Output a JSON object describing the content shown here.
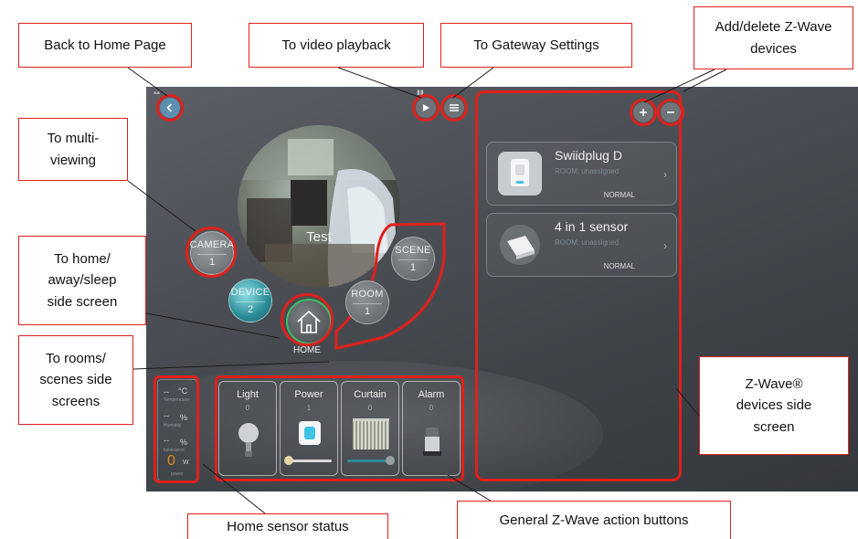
{
  "callouts": {
    "back_home": "Back to Home Page",
    "video_playback": "To video playback",
    "gateway_settings": "To Gateway Settings",
    "add_delete": "Add/delete Z-Wave devices",
    "multi_viewing": "To multi-viewing",
    "home_away": "To home/ away/sleep side screen",
    "rooms_scenes": "To rooms/ scenes side screens",
    "zwave_side": "Z-Wave® devices side screen",
    "sensor_status": "Home sensor status",
    "action_buttons": "General Z-Wave action buttons"
  },
  "camera": {
    "name": "Test"
  },
  "orbs": {
    "camera": {
      "label": "CAMERA",
      "count": "1"
    },
    "scene": {
      "label": "SCENE",
      "count": "1"
    },
    "device": {
      "label": "DEVICE",
      "count": "2"
    },
    "room": {
      "label": "ROOM",
      "count": "1"
    },
    "home": {
      "label": "HOME"
    }
  },
  "devices": [
    {
      "name": "Swiidplug D",
      "room": "ROOM: unassigned",
      "status": "NORMAL"
    },
    {
      "name": "4 in 1 sensor",
      "room": "ROOM: unassigned",
      "status": "NORMAL"
    }
  ],
  "actions": [
    {
      "label": "Light",
      "value": "0"
    },
    {
      "label": "Power",
      "value": "1"
    },
    {
      "label": "Curtain",
      "value": "0"
    },
    {
      "label": "Alarm",
      "value": "0"
    }
  ],
  "sensors": {
    "temp_value": "--",
    "temp_unit": "°C",
    "temp_label": "Temperature",
    "hum_value": "--",
    "hum_unit": "%",
    "hum_label": "Humidity",
    "lum_value": "--",
    "lum_unit": "%",
    "lum_label": "luminance",
    "power_value": "0",
    "power_unit": "W",
    "power_label": "power"
  },
  "colors": {
    "annotation_red": "#e0201b",
    "teal": "#2a8c97",
    "green": "#3bbf63",
    "orange": "#e8891a"
  },
  "icons": [
    "back-icon",
    "play-icon",
    "menu-icon",
    "plus-icon",
    "minus-icon",
    "house-icon",
    "bulb-icon",
    "plug-icon",
    "curtain-icon",
    "alarm-icon",
    "chevron-right-icon"
  ]
}
